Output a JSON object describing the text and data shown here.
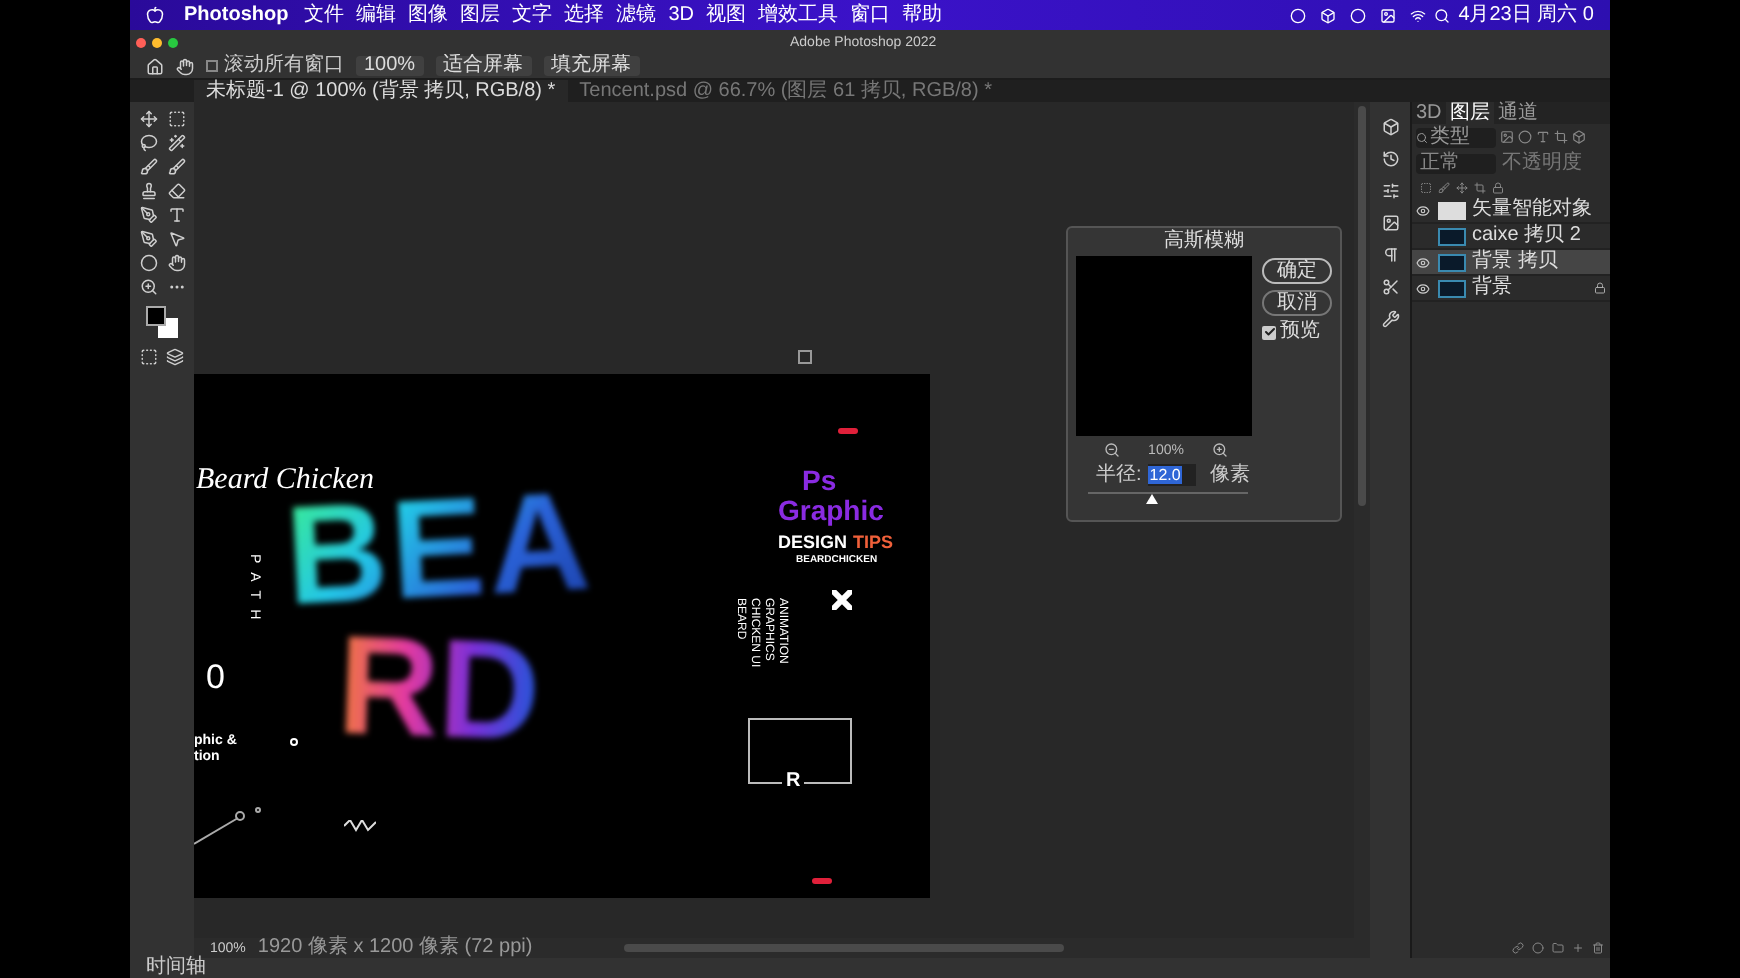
{
  "menu_bar": {
    "app": "Photoshop",
    "items": [
      "文件",
      "编辑",
      "图像",
      "图层",
      "文字",
      "选择",
      "滤镜",
      "3D",
      "视图",
      "增效工具",
      "窗口",
      "帮助"
    ],
    "clock": "4月23日 周六 0"
  },
  "window": {
    "title": "Adobe Photoshop 2022"
  },
  "options_bar": {
    "scroll_all": {
      "label": "滚动所有窗口",
      "checked": false
    },
    "buttons": [
      "100%",
      "适合屏幕",
      "填充屏幕"
    ]
  },
  "tabs": [
    {
      "label": "未标题-1 @ 100% (背景 拷贝, RGB/8) *",
      "selected": true
    },
    {
      "label": "Tencent.psd @ 66.7% (图层 61 拷贝, RGB/8) *",
      "selected": false
    }
  ],
  "artwork": {
    "script_logo": "Beard Chicken",
    "path": "PATH",
    "zero": "0",
    "line_1": "phic &",
    "line_2": "tion",
    "ps": "Ps",
    "graphic": "Graphic",
    "design": "DESIGN",
    "tips": "TIPS",
    "byline": "BEARDCHICKEN",
    "vertical_lines": [
      "BEARD",
      "CHICKEN UI",
      "GRAPHICS",
      "ANIMATION"
    ],
    "frame_letter": "R",
    "big_1": "BEA",
    "big_2": "RD"
  },
  "dialog": {
    "title": "高斯模糊",
    "buttons": [
      "确定",
      "取消"
    ],
    "preview": {
      "label": "预览",
      "checked": true
    },
    "zoom": "100%",
    "radius": {
      "label": "半径:",
      "value": "12.0",
      "unit": "像素",
      "level": 0.4
    }
  },
  "layers_panel": {
    "tabs": [
      {
        "label": "3D",
        "selected": false
      },
      {
        "label": "图层",
        "selected": true
      },
      {
        "label": "通道",
        "selected": false
      }
    ],
    "filter": "类型",
    "blend_mode": "正常",
    "opacity_label": "不透明度",
    "layers": [
      {
        "name": "矢量智能对象",
        "visible": true,
        "selected": false,
        "locked": false
      },
      {
        "name": "caixe 拷贝 2",
        "visible": false,
        "selected": false,
        "locked": false
      },
      {
        "name": "背景 拷贝",
        "visible": true,
        "selected": true,
        "locked": false
      },
      {
        "name": "背景",
        "visible": true,
        "selected": false,
        "locked": true
      }
    ]
  },
  "status_bar": {
    "zoom": "100%",
    "doc_info": "1920 像素 x 1200 像素 (72 ppi)"
  },
  "timeline": "时间轴"
}
